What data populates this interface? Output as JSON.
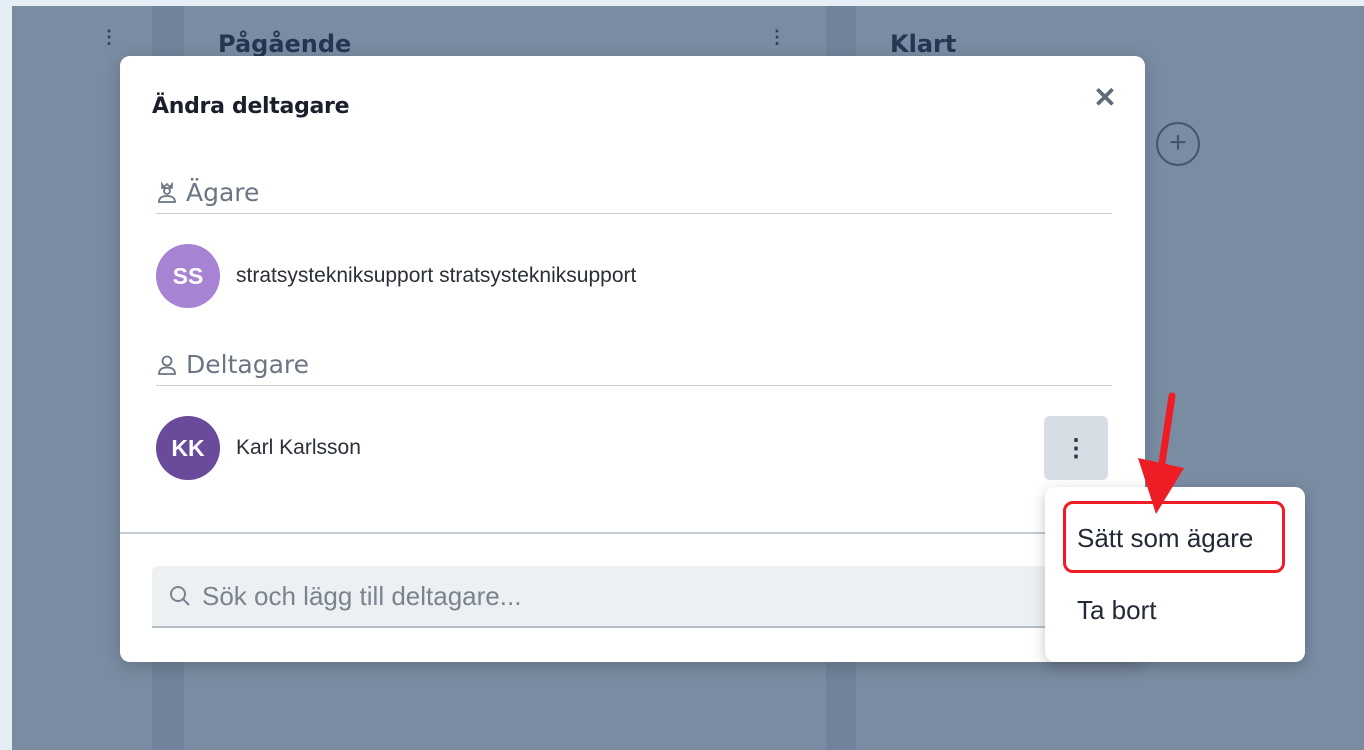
{
  "board": {
    "columns": [
      {
        "title": ""
      },
      {
        "title": "Pågående"
      },
      {
        "title": "Klart"
      }
    ]
  },
  "modal": {
    "title": "Ändra deltagare",
    "close_icon": "close-icon",
    "owners_section": {
      "label": "Ägare",
      "icon": "owner-icon",
      "members": [
        {
          "initials": "SS",
          "name": "stratsystekniksupport stratsystekniksupport",
          "avatar_color": "#a683d3"
        }
      ]
    },
    "participants_section": {
      "label": "Deltagare",
      "icon": "user-icon",
      "members": [
        {
          "initials": "KK",
          "name": "Karl Karlsson",
          "avatar_color": "#6a4a9a"
        }
      ]
    },
    "search": {
      "placeholder": "Sök och lägg till deltagare...",
      "value": "",
      "icon": "search-icon"
    }
  },
  "context_menu": {
    "items": [
      {
        "label": "Sätt som ägare",
        "highlighted": true
      },
      {
        "label": "Ta bort",
        "highlighted": false
      }
    ]
  },
  "colors": {
    "highlight": "#ee1c24",
    "overlay": "#71839a"
  }
}
